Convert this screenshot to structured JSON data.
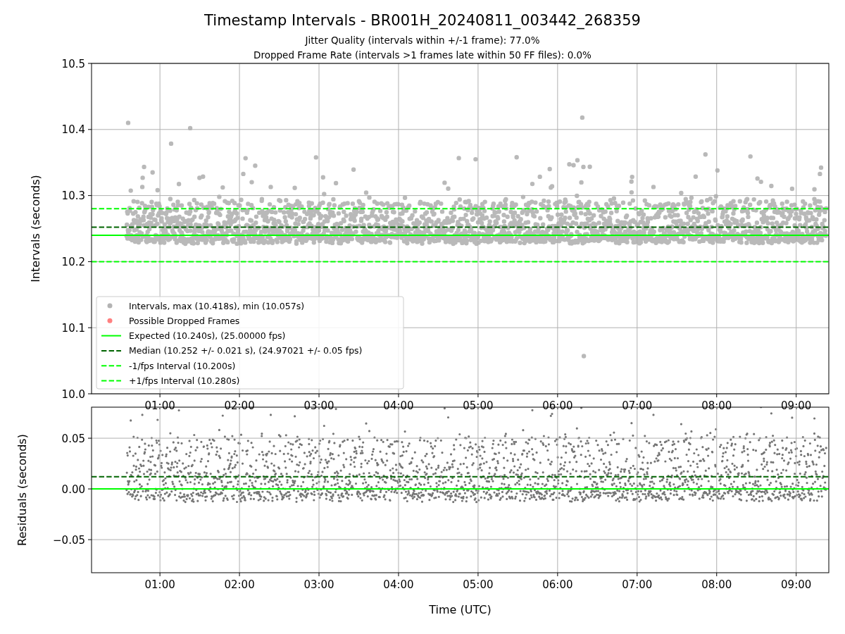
{
  "title": "Timestamp Intervals - BR001H_20240811_003442_268359",
  "subtitle": [
    "Jitter Quality (intervals within +/-1 frame): 77.0%",
    "Dropped Frame Rate (intervals >1 frames late within 50 FF files): 0.0%"
  ],
  "intervals_panel": {
    "chart_data": {
      "type": "scatter",
      "ylabel": "Intervals (seconds)",
      "xlim": [
        0.14,
        9.41
      ],
      "ylim": [
        10.0,
        10.5
      ],
      "grid": true,
      "xticks": [
        {
          "value": 1,
          "label": "01:00"
        },
        {
          "value": 2,
          "label": "02:00"
        },
        {
          "value": 3,
          "label": "03:00"
        },
        {
          "value": 4,
          "label": "04:00"
        },
        {
          "value": 5,
          "label": "05:00"
        },
        {
          "value": 6,
          "label": "06:00"
        },
        {
          "value": 7,
          "label": "07:00"
        },
        {
          "value": 8,
          "label": "08:00"
        },
        {
          "value": 9,
          "label": "09:00"
        }
      ],
      "yticks": [
        {
          "value": 10.0,
          "label": "10.0"
        },
        {
          "value": 10.1,
          "label": "10.1"
        },
        {
          "value": 10.2,
          "label": "10.2"
        },
        {
          "value": 10.3,
          "label": "10.3"
        },
        {
          "value": 10.4,
          "label": "10.4"
        },
        {
          "value": 10.5,
          "label": "10.5"
        }
      ],
      "ref_lines": [
        {
          "axis": "y",
          "value": 10.24,
          "color": "#00ff00",
          "label": "Expected (10.240s), (25.00000 fps)"
        },
        {
          "axis": "y",
          "value": 10.252,
          "color": "#006400",
          "label": "Median (10.252 +/- 0.021 s), (24.97021 +/- 0.05 fps)"
        },
        {
          "axis": "y",
          "value": 10.2,
          "color": "#00ff00",
          "label": "-1/fps Interval (10.200s)"
        },
        {
          "axis": "y",
          "value": 10.28,
          "color": "#00ff00",
          "label": "+1/fps Interval (10.280s)"
        }
      ]
    },
    "legend_markers": [
      {
        "label": "Intervals, max (10.418s), min (10.057s)",
        "color": "#b3b3b3"
      },
      {
        "label": "Possible Dropped Frames",
        "color": "#ff8080"
      }
    ]
  },
  "residuals_panel": {
    "chart_data": {
      "type": "scatter",
      "xlabel": "Time (UTC)",
      "ylabel": "Residuals (seconds)",
      "xlim": [
        0.14,
        9.41
      ],
      "ylim": [
        -0.0826,
        0.0806
      ],
      "grid": true,
      "xticks": [
        {
          "value": 1,
          "label": "01:00"
        },
        {
          "value": 2,
          "label": "02:00"
        },
        {
          "value": 3,
          "label": "03:00"
        },
        {
          "value": 4,
          "label": "04:00"
        },
        {
          "value": 5,
          "label": "05:00"
        },
        {
          "value": 6,
          "label": "06:00"
        },
        {
          "value": 7,
          "label": "07:00"
        },
        {
          "value": 8,
          "label": "08:00"
        },
        {
          "value": 9,
          "label": "09:00"
        }
      ],
      "yticks": [
        {
          "value": -0.05,
          "label": "−0.05"
        },
        {
          "value": 0,
          "label": "0.00"
        },
        {
          "value": 0.05,
          "label": "0.05"
        }
      ],
      "ref_lines": [
        {
          "axis": "y",
          "value": 0,
          "color": "#00ff00"
        },
        {
          "axis": "y",
          "value": 0.012,
          "color": "#006400"
        }
      ]
    }
  }
}
